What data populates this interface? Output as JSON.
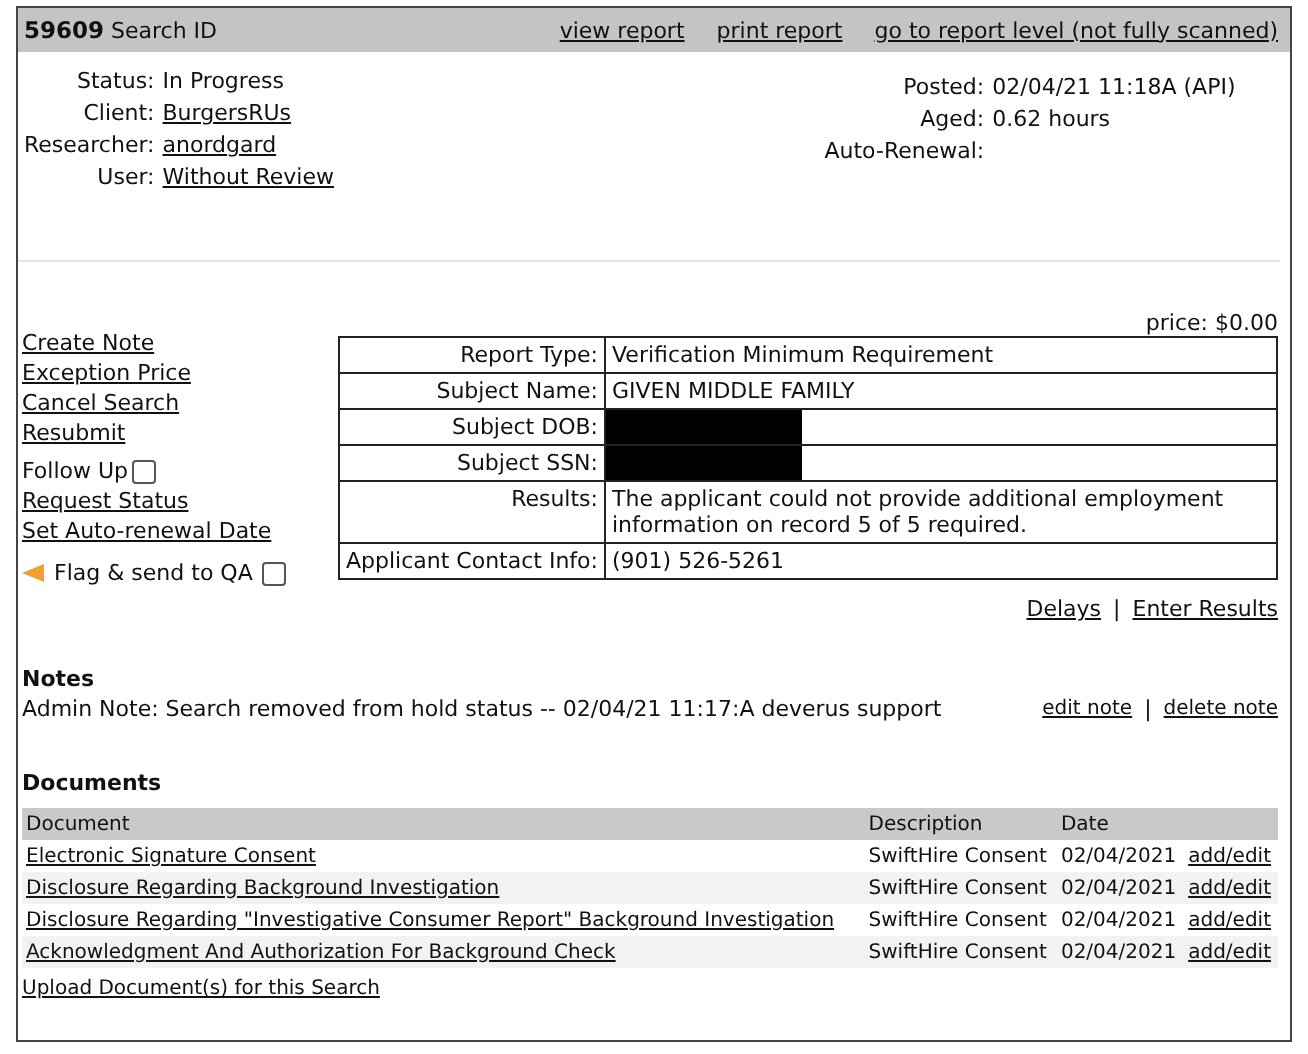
{
  "header": {
    "id": "59609",
    "id_label": "Search ID",
    "links": [
      "view report",
      "print report",
      "go to report level (not fully scanned)"
    ]
  },
  "info_left": [
    {
      "label": "Status:",
      "value": "In Progress",
      "link": false
    },
    {
      "label": "Client:",
      "value": "BurgersRUs",
      "link": true
    },
    {
      "label": "Researcher:",
      "value": "anordgard",
      "link": true
    },
    {
      "label": "User:",
      "value": "Without Review",
      "link": true
    }
  ],
  "info_right": [
    {
      "label": "Posted:",
      "value": "02/04/21 11:18A (API)"
    },
    {
      "label": "Aged:",
      "value": "0.62 hours"
    },
    {
      "label": "Auto-Renewal:"
    }
  ],
  "actions": [
    {
      "kind": "link",
      "label": "Create Note"
    },
    {
      "kind": "link",
      "label": "Exception Price"
    },
    {
      "kind": "link",
      "label": "Cancel Search"
    },
    {
      "kind": "link",
      "label": "Resubmit"
    },
    {
      "kind": "checkbox",
      "label": "Follow Up",
      "checked": false
    },
    {
      "kind": "link",
      "label": "Request Status"
    },
    {
      "kind": "link",
      "label": "Set Auto-renewal Date"
    },
    {
      "kind": "flag",
      "label": "Flag & send to QA",
      "checked": false
    }
  ],
  "price": "price: $0.00",
  "details": [
    {
      "label": "Report Type:",
      "value": "Verification Minimum Requirement",
      "redacted": false
    },
    {
      "label": "Subject Name:",
      "value": "GIVEN MIDDLE FAMILY",
      "redacted": false
    },
    {
      "label": "Subject DOB:",
      "redacted": true
    },
    {
      "label": "Subject SSN:",
      "redacted": true
    },
    {
      "label": "Results:",
      "value": "The applicant could not provide additional employment information on record 5 of 5 required.",
      "redacted": false
    },
    {
      "label": "Applicant Contact Info:",
      "value": "(901) 526-5261",
      "redacted": false
    }
  ],
  "detail_links": [
    "Delays",
    "Enter Results"
  ],
  "detail_links_separator": "|",
  "notes": {
    "title": "Notes",
    "items": [
      {
        "text": "Admin Note: Search removed from hold status -- 02/04/21 11:17:A deverus support",
        "edit": "edit note",
        "separator": "|",
        "delete": "delete note"
      }
    ]
  },
  "documents": {
    "title": "Documents",
    "columns": [
      "Document",
      "Description",
      "Date"
    ],
    "rows": [
      {
        "document": "Electronic Signature Consent",
        "description": "SwiftHire Consent",
        "date": "02/04/2021",
        "action": "add/edit"
      },
      {
        "document": "Disclosure Regarding Background Investigation",
        "description": "SwiftHire Consent",
        "date": "02/04/2021",
        "action": "add/edit"
      },
      {
        "document": "Disclosure Regarding \"Investigative Consumer Report\" Background Investigation",
        "description": "SwiftHire Consent",
        "date": "02/04/2021",
        "action": "add/edit"
      },
      {
        "document": "Acknowledgment And Authorization For Background Check",
        "description": "SwiftHire Consent",
        "date": "02/04/2021",
        "action": "add/edit"
      }
    ],
    "upload": "Upload Document(s) for this Search"
  }
}
